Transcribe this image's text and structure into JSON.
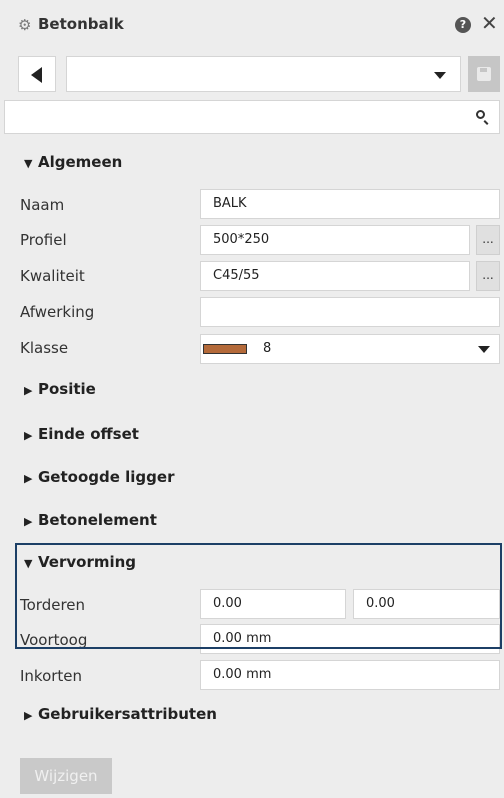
{
  "window": {
    "title": "Betonbalk",
    "help_label": "?",
    "close_label": "✕"
  },
  "toolbar": {
    "preset_value": "",
    "search_value": "",
    "search_placeholder": ""
  },
  "sections": {
    "algemeen": "Algemeen",
    "positie": "Positie",
    "einde_offset": "Einde offset",
    "getoogde_ligger": "Getoogde ligger",
    "betonelement": "Betonelement",
    "vervorming": "Vervorming",
    "gebruikersattributen": "Gebruikersattributen"
  },
  "algemeen": {
    "naam_label": "Naam",
    "naam_value": "BALK",
    "profiel_label": "Profiel",
    "profiel_value": "500*250",
    "kwaliteit_label": "Kwaliteit",
    "kwaliteit_value": "C45/55",
    "afwerking_label": "Afwerking",
    "afwerking_value": "",
    "klasse_label": "Klasse",
    "klasse_value": "8",
    "klasse_color": "#b46a3a",
    "browse_label": "..."
  },
  "vervorming": {
    "torderen_label": "Torderen",
    "torderen_start": "0.00",
    "torderen_end": "0.00",
    "voortoog_label": "Voortoog",
    "voortoog_value": "0.00 mm"
  },
  "inkorten": {
    "label": "Inkorten",
    "value": "0.00 mm"
  },
  "actions": {
    "apply_label": "Wijzigen"
  },
  "icons": [
    "gear-icon",
    "help-icon",
    "close-icon",
    "back-arrow-icon",
    "dropdown-caret-icon",
    "save-icon",
    "search-icon"
  ],
  "colors": {
    "highlight_border": "#1c3f66",
    "background": "#ededed"
  }
}
